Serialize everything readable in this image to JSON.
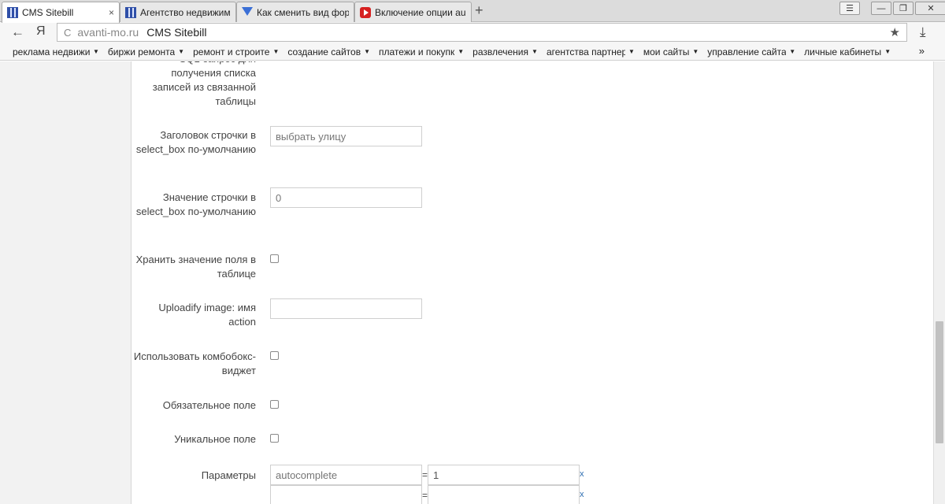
{
  "tabs": [
    {
      "label": "CMS Sitebill",
      "active": true,
      "favicon": "cms-favicon"
    },
    {
      "label": "Агентство недвижимо",
      "active": false,
      "favicon": "cms-favicon"
    },
    {
      "label": "Как сменить вид форм",
      "active": false,
      "favicon": "triangle-favicon"
    },
    {
      "label": "Включение опции au",
      "active": false,
      "favicon": "youtube-favicon"
    }
  ],
  "tab_close_glyph": "×",
  "new_tab_glyph": "+",
  "window_controls": {
    "menu": "☰",
    "minimize": "—",
    "restore": "❐",
    "close": "✕"
  },
  "toolbar": {
    "back_glyph": "←",
    "yandex_glyph": "Я",
    "reload_glyph": "C",
    "domain": "avanti-mo.ru",
    "page_title": "CMS Sitebill",
    "star_glyph": "★",
    "download_glyph": "⤓"
  },
  "bookmarks": [
    {
      "label": "реклама недвижи"
    },
    {
      "label": "биржи ремонта"
    },
    {
      "label": "ремонт и строите"
    },
    {
      "label": "создание сайтов"
    },
    {
      "label": "платежи и покупк"
    },
    {
      "label": "развлечения"
    },
    {
      "label": "агентства партнер"
    },
    {
      "label": "мои сайты"
    },
    {
      "label": "управление сайта"
    },
    {
      "label": "личные кабинеты"
    }
  ],
  "bookmark_arrow": "▼",
  "bookmarks_more": "»",
  "form": {
    "sql_label": "SQL-запрос для получения списка записей из связанной таблицы",
    "select_title_label": "Заголовок строчки в select_box по-умолчанию",
    "select_title_value": "выбрать улицу",
    "select_value_label": "Значение строчки в select_box по-умолчанию",
    "select_value_value": "0",
    "store_value_label": "Хранить значение поля в таблице",
    "uploadify_label": "Uploadify image: имя action",
    "uploadify_value": "",
    "combobox_label": "Использовать комбобокс-виджет",
    "required_label": "Обязательное поле",
    "unique_label": "Уникальное поле",
    "params_label": "Параметры",
    "params": [
      {
        "key": "autocomplete",
        "value": "1"
      },
      {
        "key": "",
        "value": ""
      }
    ],
    "eq_glyph": "=",
    "remove_glyph": "x"
  }
}
